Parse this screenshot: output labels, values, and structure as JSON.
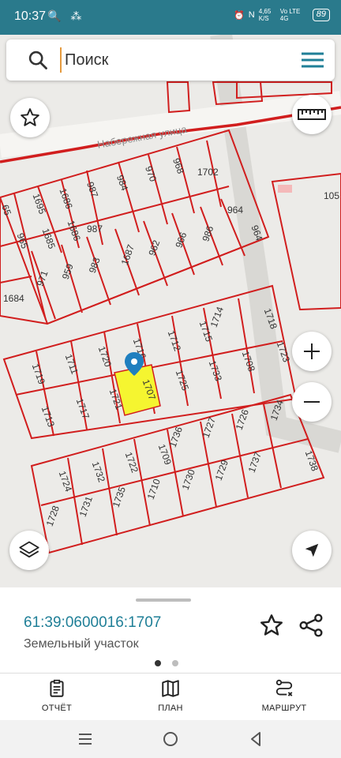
{
  "status_bar": {
    "time": "10:37",
    "icons_left": "🔍 ⁂",
    "net_speed": "4,65 K/S",
    "network": "Vo LTE 4G",
    "battery": "89"
  },
  "search": {
    "placeholder": "Поиск"
  },
  "map": {
    "street_label": "Набережная улица",
    "parcels": [
      "65",
      "1695",
      "1686",
      "987",
      "984",
      "970",
      "968",
      "1702",
      "964",
      "987",
      "1686",
      "1685",
      "965",
      "1687",
      "962",
      "966",
      "986",
      "964",
      "971",
      "959",
      "983",
      "1684",
      "1718",
      "1714",
      "1715",
      "1712",
      "1716",
      "1720",
      "1711",
      "1719",
      "1723",
      "1708",
      "1733",
      "1725",
      "1707",
      "1721",
      "1717",
      "1713",
      "1734",
      "1726",
      "1727",
      "1736",
      "1709",
      "1722",
      "1732",
      "1724",
      "1738",
      "1737",
      "1729",
      "1730",
      "1710",
      "1735",
      "1731",
      "1728",
      "105"
    ],
    "selected_parcel": "1707",
    "highlight_color": "#f5f530",
    "boundary_color": "#d11e1e"
  },
  "bottom_sheet": {
    "cadastral_number": "61:39:0600016:1707",
    "parcel_type": "Земельный участок"
  },
  "tabs": [
    {
      "label": "ОТЧЁТ",
      "icon": "clipboard-icon"
    },
    {
      "label": "ПЛАН",
      "icon": "map-icon"
    },
    {
      "label": "МАРШРУТ",
      "icon": "route-icon"
    }
  ],
  "colors": {
    "status_bar": "#2a7a8c",
    "accent": "#1f7f97",
    "menu_icon": "#1f7f97"
  }
}
